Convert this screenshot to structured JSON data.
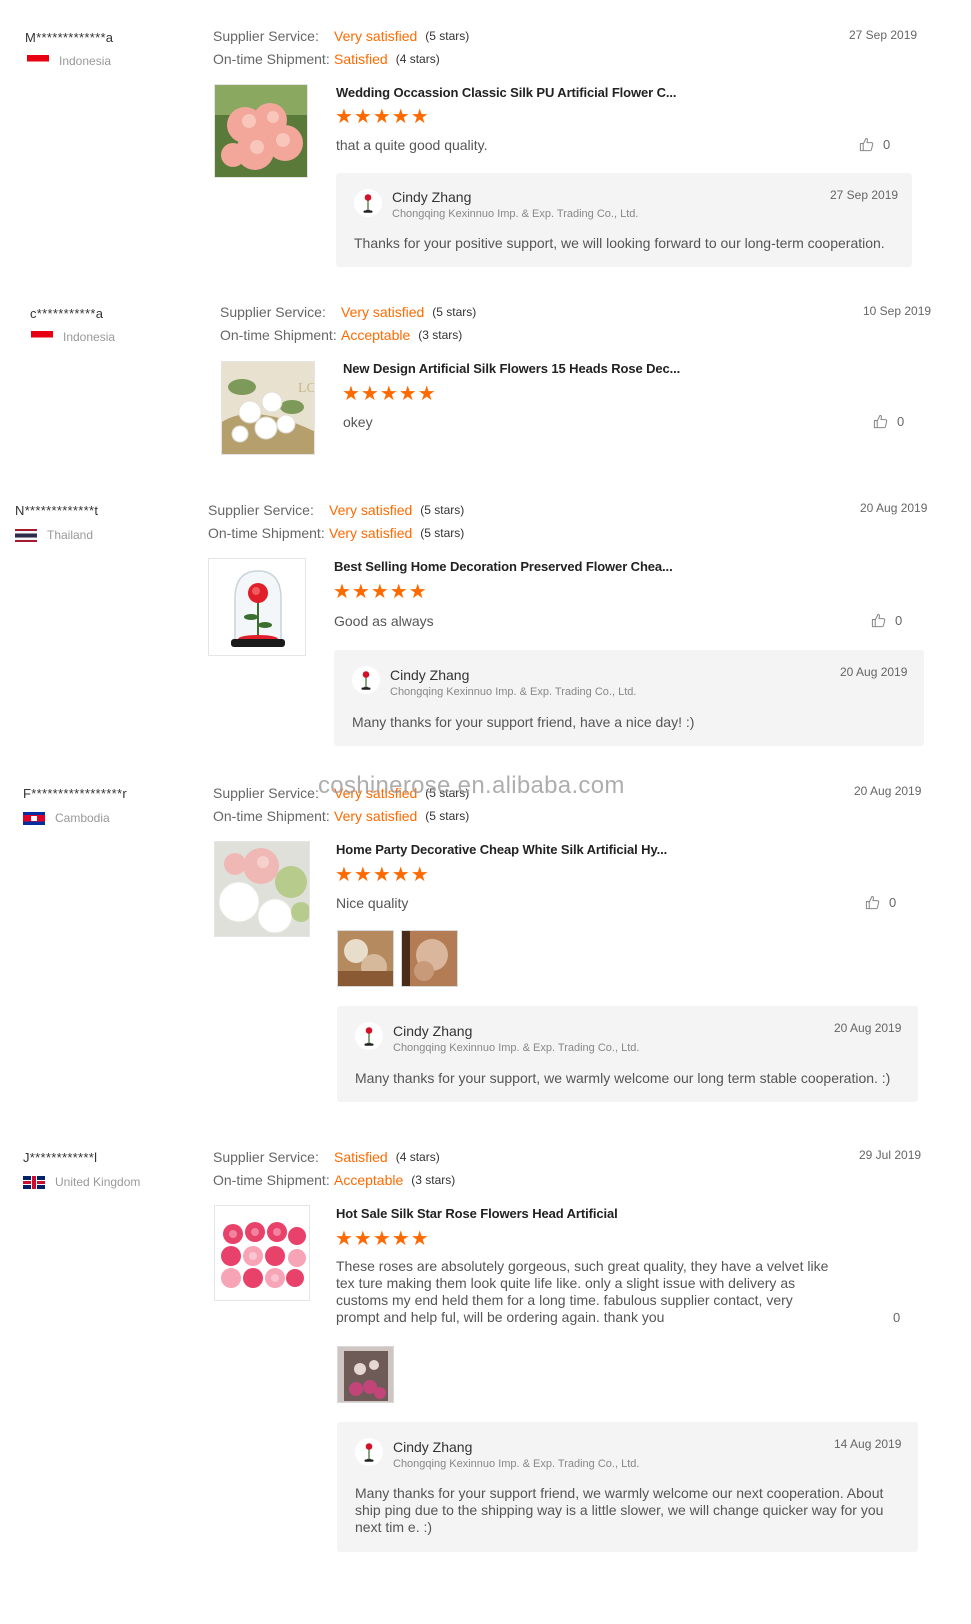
{
  "labels": {
    "supplier_service": "Supplier Service:",
    "ontime_shipment": "On-time Shipment:"
  },
  "colors": {
    "accent": "#ff6a00",
    "reply_bg": "#f4f4f4",
    "muted": "#999999"
  },
  "watermark": "coshinerose.en.alibaba.com",
  "reviews": [
    {
      "buyer": "M*************a",
      "country": "Indonesia",
      "flag": "flag-indonesia",
      "supplier_value": "Very satisfied",
      "supplier_stars": "(5 stars)",
      "shipment_value": "Satisfied",
      "shipment_stars": "(4 stars)",
      "date": "27 Sep 2019",
      "product": "Wedding Occassion Classic Silk PU Artificial Flower C...",
      "rating": 5,
      "stars_text": "★★★★★",
      "comment": "that a quite good quality.",
      "likes": "0",
      "reply": {
        "name": "Cindy Zhang",
        "company": "Chongqing Kexinnuo Imp. & Exp. Trading Co., Ltd.",
        "date": "27 Sep 2019",
        "text": "Thanks for your positive support, we will looking forward to our long-term cooperation."
      }
    },
    {
      "buyer": "c***********a",
      "country": "Indonesia",
      "flag": "flag-indonesia",
      "supplier_value": "Very satisfied",
      "supplier_stars": "(5 stars)",
      "shipment_value": "Acceptable",
      "shipment_stars": "(3 stars)",
      "date": "10 Sep 2019",
      "product": "New Design Artificial Silk Flowers 15 Heads Rose Dec...",
      "rating": 5,
      "stars_text": "★★★★★",
      "comment": "okey",
      "likes": "0"
    },
    {
      "buyer": "N*************t",
      "country": "Thailand",
      "flag": "flag-thailand",
      "supplier_value": "Very satisfied",
      "supplier_stars": "(5 stars)",
      "shipment_value": "Very satisfied",
      "shipment_stars": "(5 stars)",
      "date": "20 Aug 2019",
      "product": "Best Selling Home Decoration Preserved Flower Chea...",
      "rating": 5,
      "stars_text": "★★★★★",
      "comment": "Good as always",
      "likes": "0",
      "reply": {
        "name": "Cindy Zhang",
        "company": "Chongqing Kexinnuo Imp. & Exp. Trading Co., Ltd.",
        "date": "20 Aug 2019",
        "text": "Many thanks for your support friend,  have a nice day! :)"
      }
    },
    {
      "buyer": "F*****************r",
      "country": "Cambodia",
      "flag": "flag-cambodia",
      "supplier_value": "Very satisfied",
      "supplier_stars": "(5 stars)",
      "shipment_value": "Very satisfied",
      "shipment_stars": "(5 stars)",
      "date": "20 Aug 2019",
      "product": "Home Party Decorative Cheap White Silk Artificial Hy...",
      "rating": 5,
      "stars_text": "★★★★★",
      "comment": "Nice quality",
      "likes": "0",
      "reply": {
        "name": "Cindy Zhang",
        "company": "Chongqing Kexinnuo Imp. & Exp. Trading Co., Ltd.",
        "date": "20 Aug 2019",
        "text": "Many thanks for your support, we warmly welcome our long term stable cooperation. :)"
      }
    },
    {
      "buyer": "J************l",
      "country": "United Kingdom",
      "flag": "flag-uk",
      "supplier_value": "Satisfied",
      "supplier_stars": "(4 stars)",
      "shipment_value": "Acceptable",
      "shipment_stars": "(3 stars)",
      "date": "29 Jul 2019",
      "product": "Hot Sale Silk Star Rose Flowers Head Artificial",
      "rating": 5,
      "stars_text": "★★★★★",
      "comment": "These roses are absolutely gorgeous, such great quality, they have a velvet like tex ture making them look quite life like. only a slight issue with delivery as customs my end held them for a long time. fabulous supplier contact, very prompt and help ful, will be ordering again. thank you",
      "likes": "0",
      "reply": {
        "name": "Cindy Zhang",
        "company": "Chongqing Kexinnuo Imp. & Exp. Trading Co., Ltd.",
        "date": "14 Aug 2019",
        "text": "Many thanks for your support friend, we warmly welcome our next cooperation. About ship ping due to the shipping way is a little slower, we will change quicker way for you next tim e. :)"
      }
    }
  ]
}
